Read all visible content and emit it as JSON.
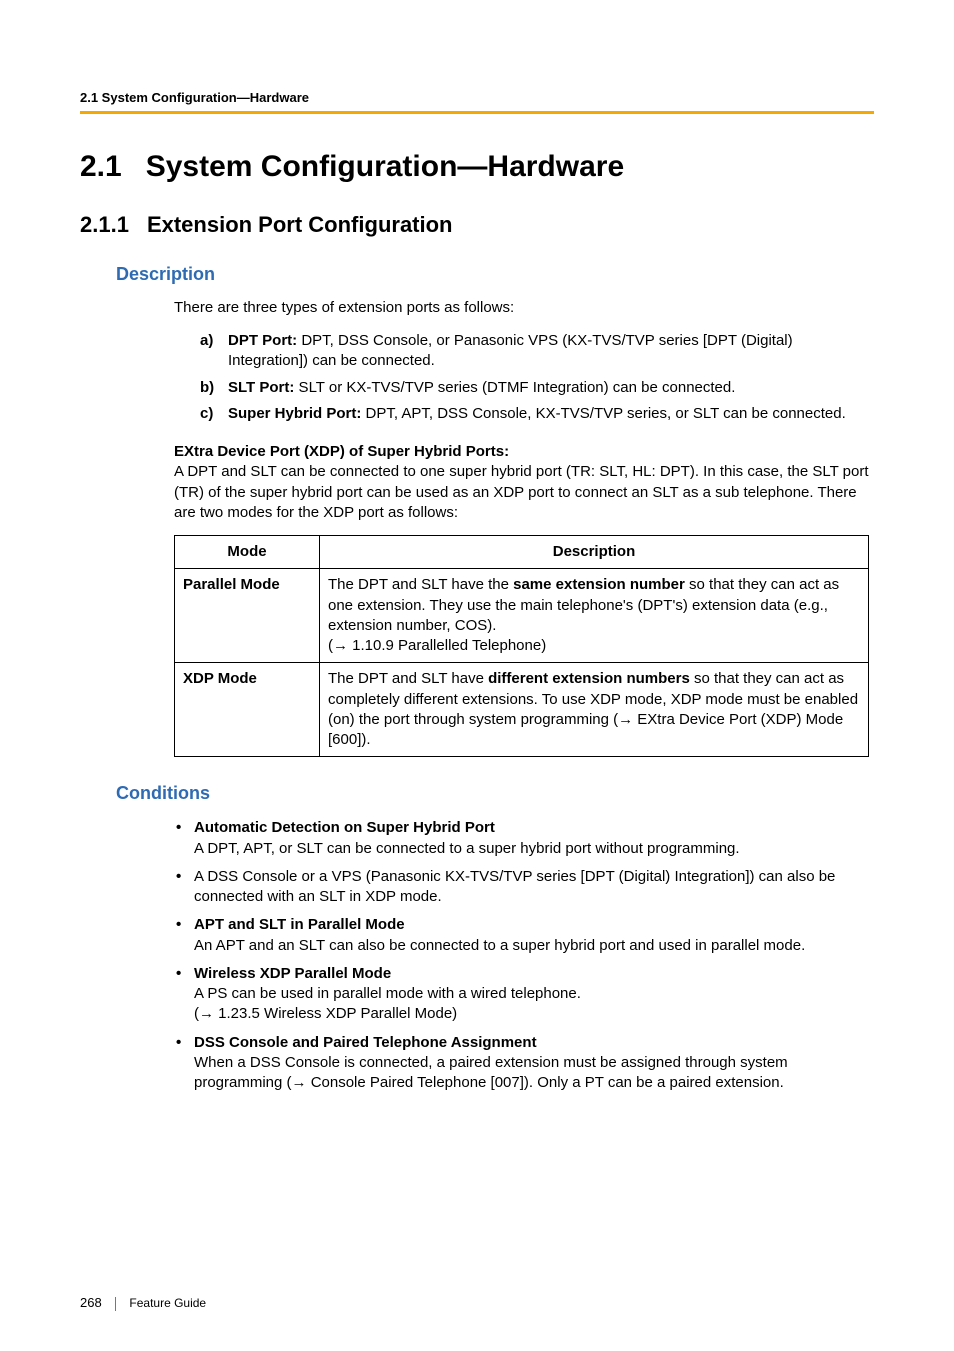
{
  "running_head": "2.1 System Configuration—Hardware",
  "h1": {
    "num": "2.1",
    "title": "System Configuration—Hardware"
  },
  "h2": {
    "num": "2.1.1",
    "title": "Extension Port Configuration"
  },
  "description": {
    "heading": "Description",
    "intro": "There are three types of extension ports as follows:",
    "items": [
      {
        "marker": "a)",
        "bold": "DPT Port:",
        "text": " DPT, DSS Console, or Panasonic VPS (KX-TVS/TVP series [DPT (Digital) Integration]) can be connected."
      },
      {
        "marker": "b)",
        "bold": "SLT Port:",
        "text": " SLT or KX-TVS/TVP series (DTMF Integration) can be connected."
      },
      {
        "marker": "c)",
        "bold": "Super Hybrid Port:",
        "text": " DPT, APT, DSS Console, KX-TVS/TVP series, or SLT can be connected."
      }
    ],
    "xdp": {
      "subhead": "EXtra Device Port (XDP) of Super Hybrid Ports:",
      "body": "A DPT and SLT can be connected to one super hybrid port (TR: SLT, HL: DPT). In this case, the SLT port (TR) of the super hybrid port can be used as an XDP port to connect an SLT as a sub telephone. There are two modes for the XDP port as follows:"
    },
    "table": {
      "headers": {
        "mode": "Mode",
        "desc": "Description"
      },
      "rows": [
        {
          "mode": "Parallel Mode",
          "pre": "The DPT and SLT have the ",
          "bold": "same extension number",
          "post": " so that they can act as one extension. They use the main telephone's (DPT's) extension data (e.g., extension number, COS).",
          "ref": " 1.10.9 Parallelled Telephone)"
        },
        {
          "mode": "XDP Mode",
          "pre": "The DPT and SLT have ",
          "bold": "different extension numbers",
          "post": " so that they can act as completely different extensions. To use XDP mode, XDP mode must be enabled (on) the port through system programming (",
          "ref": " EXtra Device Port (XDP) Mode [600])."
        }
      ]
    }
  },
  "conditions": {
    "heading": "Conditions",
    "items": [
      {
        "title": "Automatic Detection on Super Hybrid Port",
        "body": "A DPT, APT, or SLT can be connected to a super hybrid port without programming."
      },
      {
        "title": "",
        "body": "A DSS Console or a VPS (Panasonic KX-TVS/TVP series [DPT (Digital) Integration]) can also be connected with an SLT in XDP mode."
      },
      {
        "title": "APT and SLT in Parallel Mode",
        "body": "An APT and an SLT can also be connected to a super hybrid port and used in parallel mode."
      },
      {
        "title": "Wireless XDP Parallel Mode",
        "body": "A PS can be used in parallel mode with a wired telephone.",
        "ref": " 1.23.5 Wireless XDP Parallel Mode)"
      },
      {
        "title": "DSS Console and Paired Telephone Assignment",
        "body": "When a DSS Console is connected, a paired extension must be assigned through system programming (",
        "ref": " Console Paired Telephone [007]). Only a PT can be a paired extension."
      }
    ]
  },
  "footer": {
    "page": "268",
    "label": "Feature Guide"
  },
  "glyphs": {
    "arrow": "→"
  }
}
